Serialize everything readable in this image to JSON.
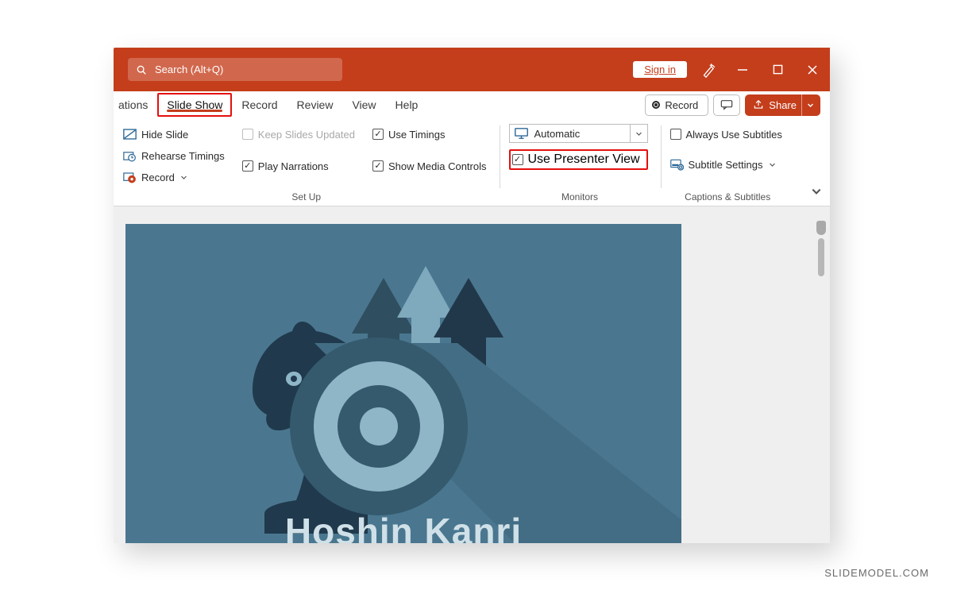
{
  "titlebar": {
    "search_placeholder": "Search (Alt+Q)",
    "signin": "Sign in"
  },
  "tabs": {
    "t0": "ations",
    "t1": "Slide Show",
    "t2": "Record",
    "t3": "Review",
    "t4": "View",
    "t5": "Help",
    "record_btn": "Record",
    "share_btn": "Share"
  },
  "ribbon": {
    "setup": {
      "hide_slide": "Hide Slide",
      "rehearse": "Rehearse Timings",
      "record": "Record",
      "keep_updated": "Keep Slides Updated",
      "play_narr": "Play Narrations",
      "use_timings": "Use Timings",
      "show_media": "Show Media Controls",
      "group": "Set Up"
    },
    "monitors": {
      "selected": "Automatic",
      "presenter": "Use Presenter View",
      "group": "Monitors"
    },
    "captions": {
      "always": "Always Use Subtitles",
      "settings": "Subtitle Settings",
      "group": "Captions & Subtitles"
    }
  },
  "slide": {
    "title": "Hoshin Kanri"
  },
  "watermark": "SLIDEMODEL.COM",
  "colors": {
    "brand": "#c43e1c",
    "highlight": "#e4100e",
    "slide_bg": "#4a778f"
  }
}
